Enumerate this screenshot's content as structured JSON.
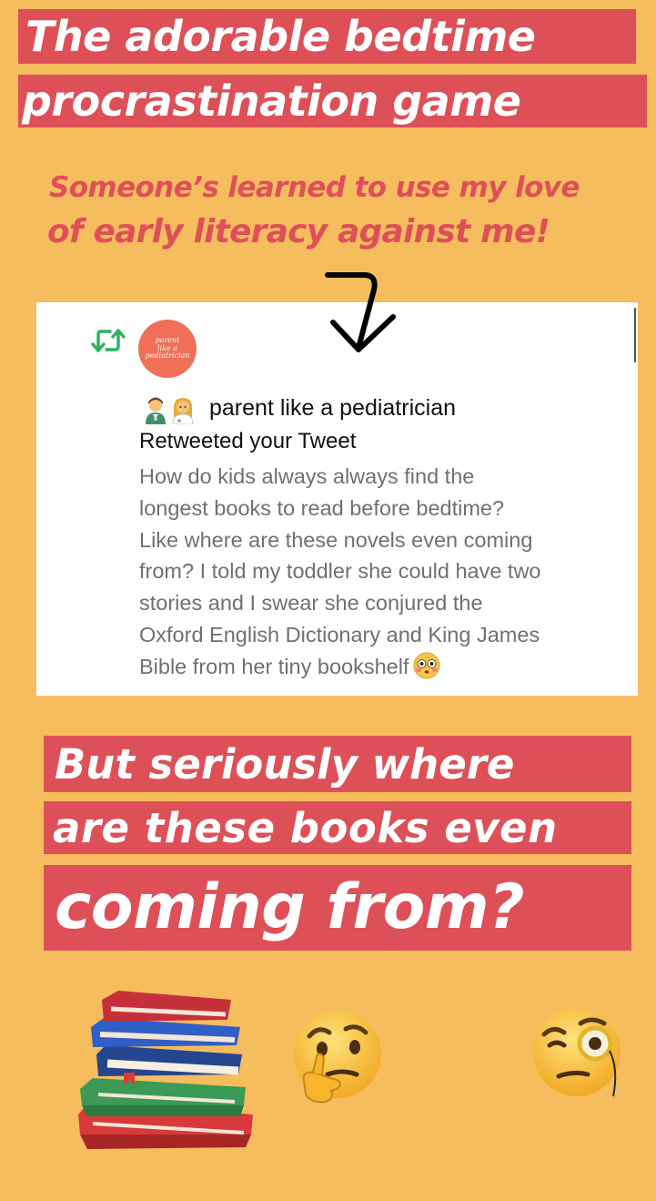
{
  "title": {
    "line1": "The adorable bedtime",
    "line2": "procrastination game"
  },
  "subtitle": {
    "line1": "Someone’s learned to use my love",
    "line2": "of early literacy against me!"
  },
  "arrow": {
    "icon": "curved-down-arrow-icon"
  },
  "notification": {
    "avatar_text": [
      "parent",
      "like a",
      "pediatrician"
    ],
    "account_name": "parent like a pediatrician",
    "action_text": "Retweeted your Tweet",
    "tweet_lines": [
      "How do kids always always find the",
      "longest books to read before bedtime?",
      "Like where are these novels even coming",
      "from? I told my toddler she could have two",
      "stories and I swear she conjured the",
      "Oxford English Dictionary and King James",
      "Bible from her tiny bookshelf"
    ],
    "retweet_color": "#2bb35f"
  },
  "question": {
    "line1": "But seriously where",
    "line2": "are these books even",
    "line3": "coming from?"
  },
  "colors": {
    "background": "#f5bd5e",
    "band": "#dd5058",
    "subtitle": "#e04e5a"
  },
  "stickers": [
    "books-emoji",
    "thinking-face-emoji",
    "face-with-monocle-emoji"
  ]
}
